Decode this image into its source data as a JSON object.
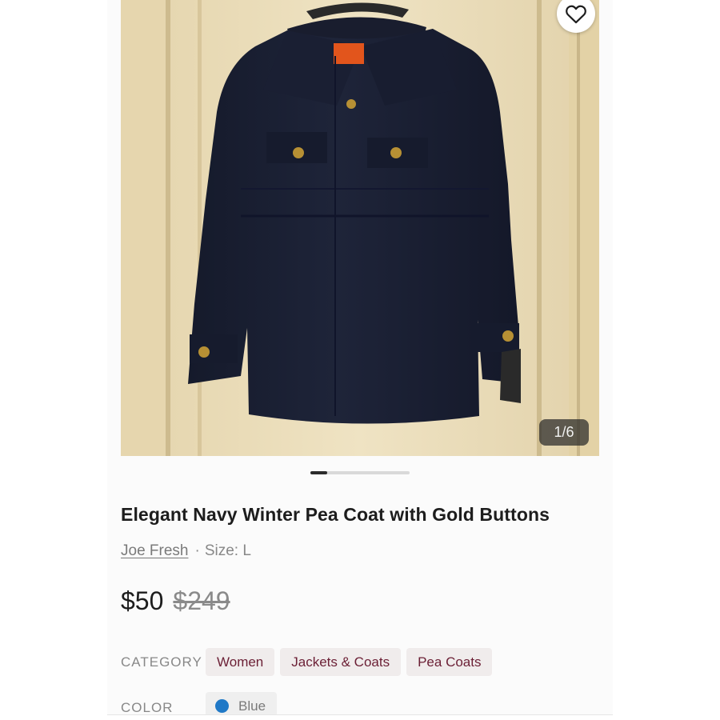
{
  "gallery": {
    "counter": "1/6",
    "favorite_icon": "heart-outline-icon",
    "current_index": 1,
    "total": 6
  },
  "listing": {
    "title": "Elegant Navy Winter Pea Coat with Gold Buttons",
    "brand": "Joe Fresh",
    "separator": "·",
    "size": "Size: L",
    "price": "$50",
    "original_price": "$249"
  },
  "category": {
    "label": "CATEGORY",
    "chips": [
      "Women",
      "Jackets & Coats",
      "Pea Coats"
    ]
  },
  "color": {
    "label": "COLOR",
    "value": "Blue",
    "swatch_hex": "#2079c7"
  },
  "colors": {
    "chip_text": "#6b1f35",
    "chip_bg": "#f0ecec",
    "coat": "#1d2236"
  }
}
